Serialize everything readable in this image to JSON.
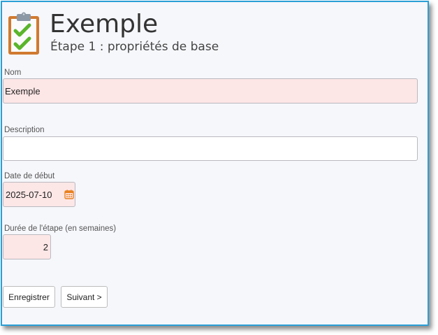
{
  "header": {
    "title": "Exemple",
    "subtitle": "Étape 1 : propriétés de base",
    "icon": "clipboard-checklist-icon"
  },
  "form": {
    "name": {
      "label": "Nom",
      "value": "Exemple"
    },
    "description": {
      "label": "Description",
      "value": ""
    },
    "start_date": {
      "label": "Date de début",
      "value": "2025-07-10",
      "icon": "calendar-icon"
    },
    "duration": {
      "label": "Durée de l'étape (en semaines)",
      "value": "2"
    }
  },
  "buttons": {
    "save_label": "Enregistrer",
    "next_label": "Suivant >"
  },
  "colors": {
    "window_border": "#2a9fd6",
    "required_field_bg": "#fde6e6",
    "calendar_icon": "#e8801e",
    "check_green": "#5ab52a",
    "clipboard_board": "#d07a30"
  }
}
